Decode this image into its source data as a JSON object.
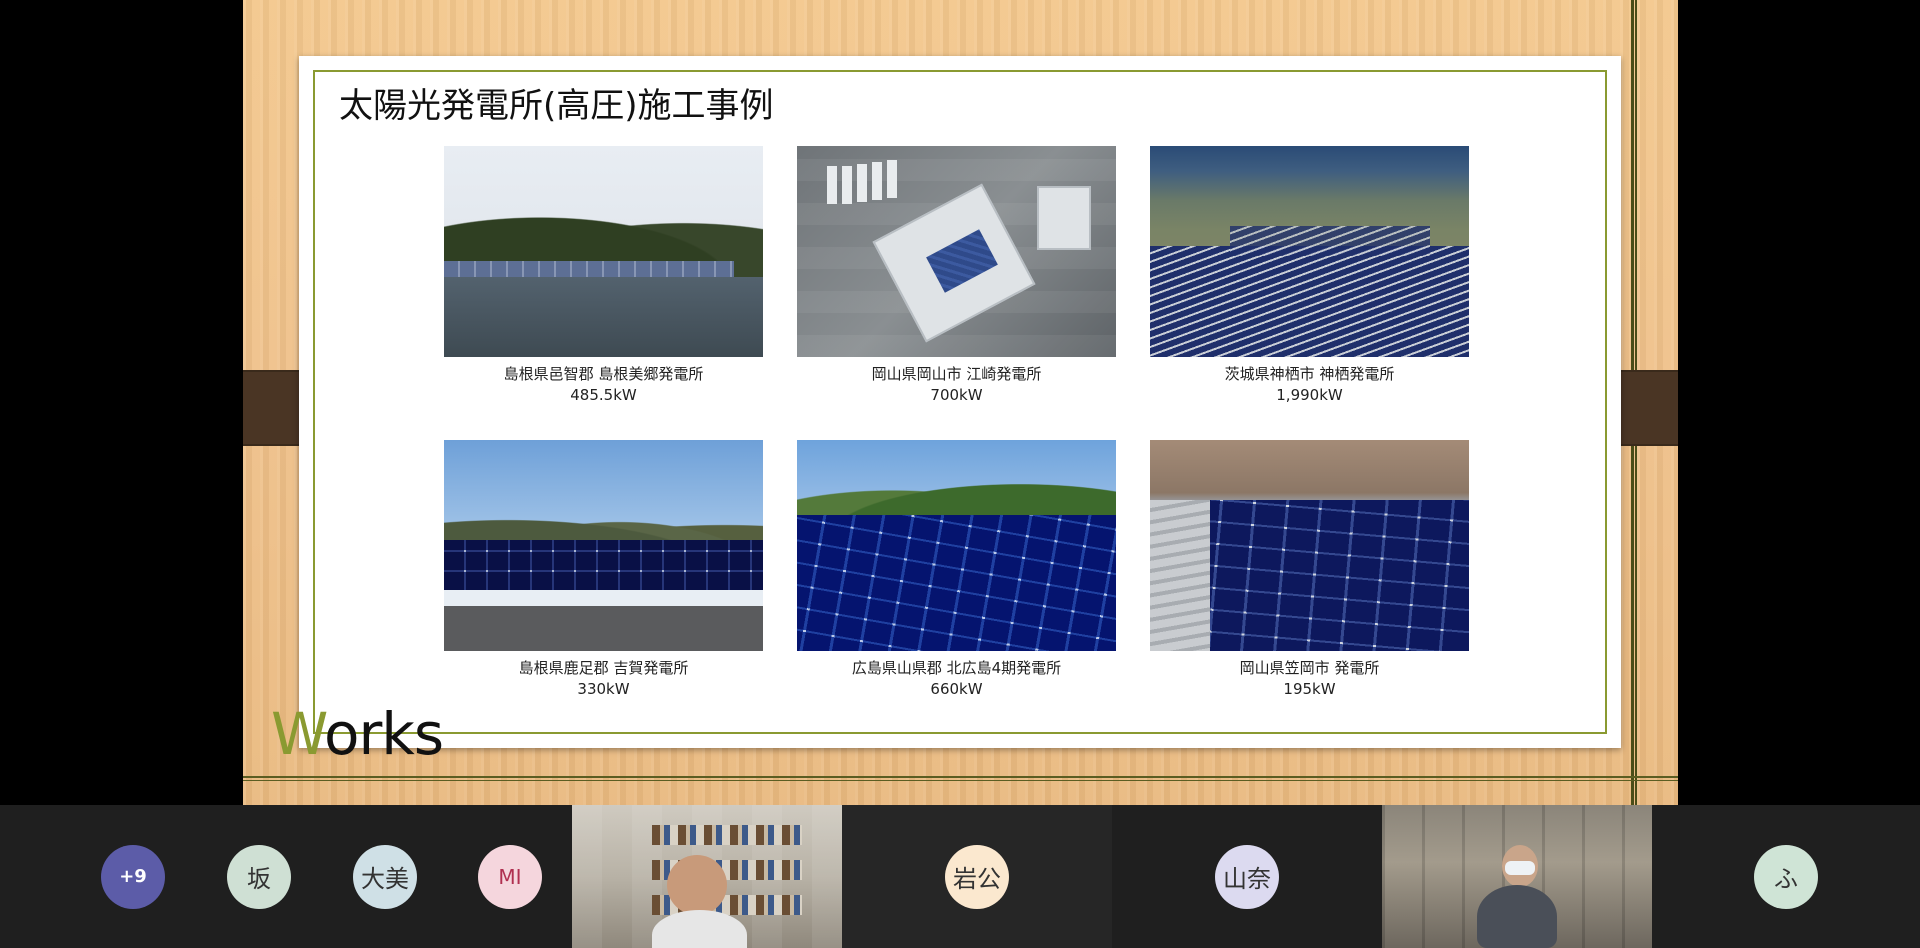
{
  "slide": {
    "title": "太陽光発電所(高圧)施工事例",
    "works_first": "W",
    "works_rest": "orks",
    "cases": [
      {
        "location": "島根県邑智郡 島根美郷発電所",
        "power": "485.5kW"
      },
      {
        "location": "岡山県岡山市 江崎発電所",
        "power": "700kW"
      },
      {
        "location": "茨城県神栖市 神栖発電所",
        "power": "1,990kW"
      },
      {
        "location": "島根県鹿足郡 吉賀発電所",
        "power": "330kW"
      },
      {
        "location": "広島県山県郡 北広島4期発電所",
        "power": "660kW"
      },
      {
        "location": "岡山県笠岡市 発電所",
        "power": "195kW"
      }
    ]
  },
  "participants": {
    "overflow_count": "+9",
    "tiles": [
      {
        "initials": "坂",
        "color": "#cfe0d4"
      },
      {
        "initials": "大美",
        "color": "#cfe0e6"
      },
      {
        "initials": "MI",
        "color": "#f5d6dd"
      },
      {
        "initials": "岩公",
        "color": "#fbe8cf"
      },
      {
        "initials": "山奈",
        "color": "#dcdaf0"
      },
      {
        "initials": "ふ",
        "color": "#cfe4d6"
      }
    ]
  },
  "colors": {
    "accent_green": "#8a9a31",
    "more_avatar": "#5c5ca8"
  }
}
